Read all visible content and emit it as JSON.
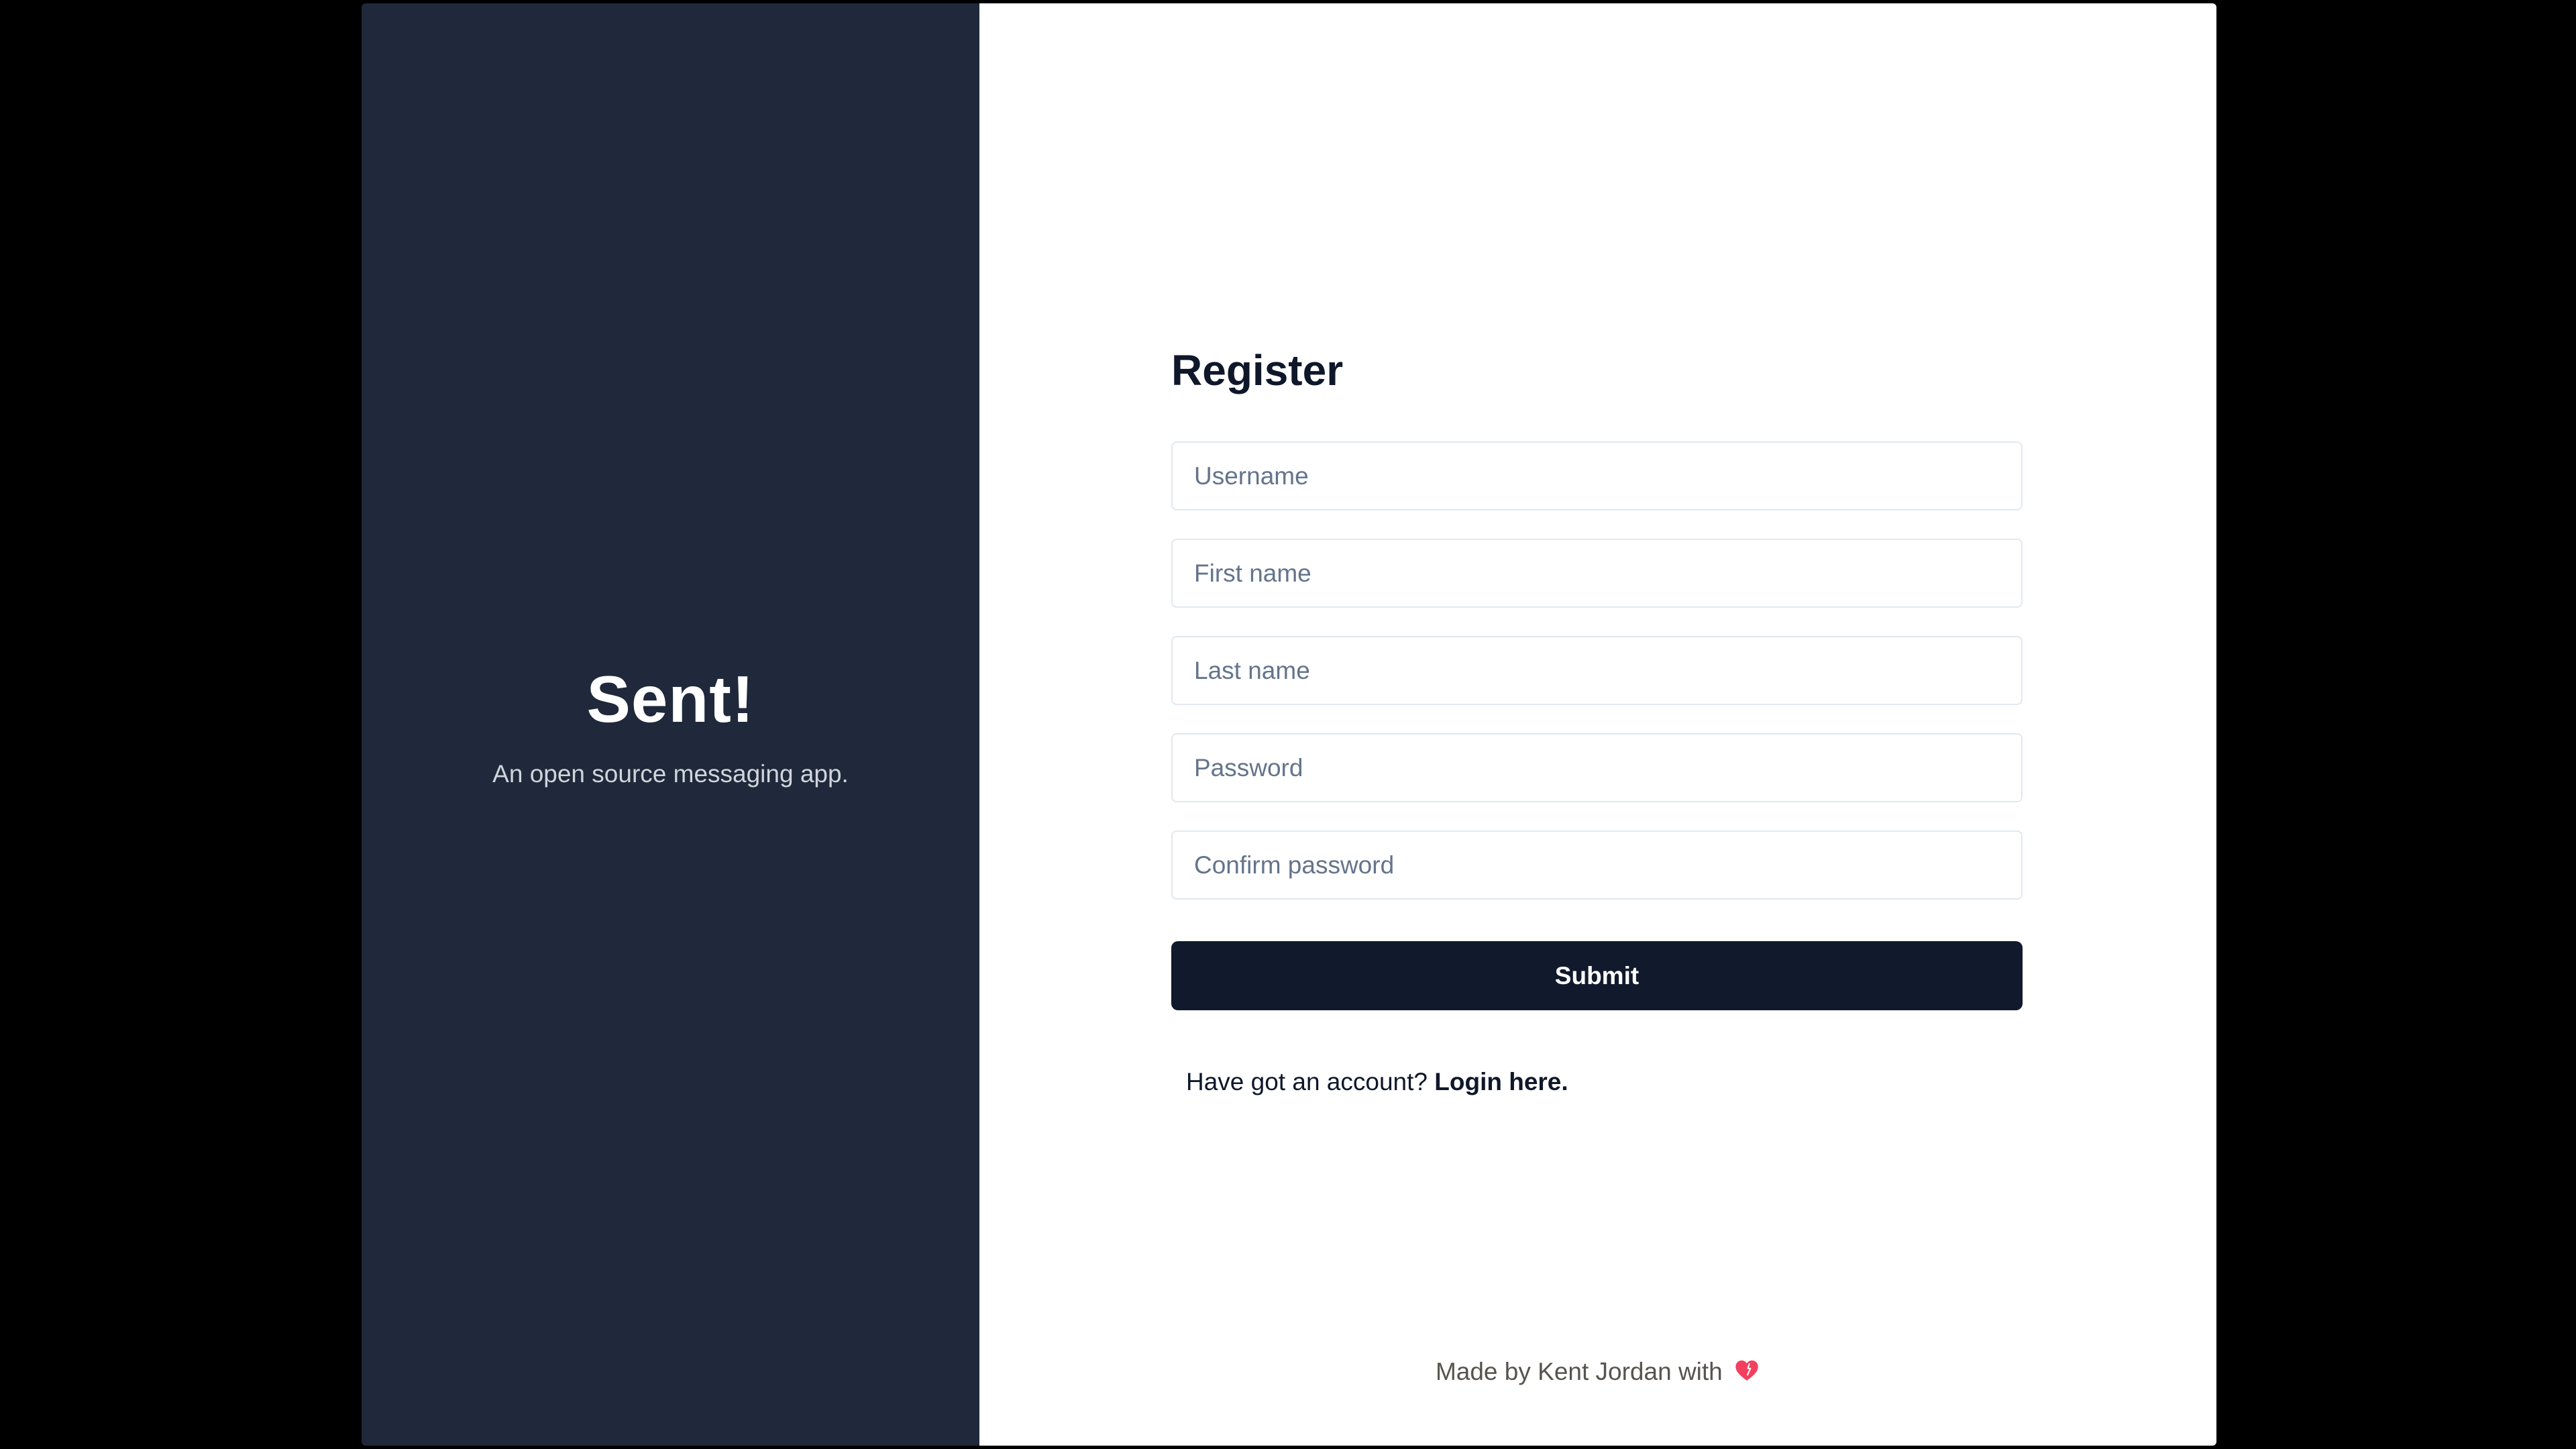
{
  "brand": {
    "title": "Sent!",
    "tagline": "An open source messaging app."
  },
  "form": {
    "title": "Register",
    "fields": {
      "username": {
        "placeholder": "Username",
        "value": ""
      },
      "first_name": {
        "placeholder": "First name",
        "value": ""
      },
      "last_name": {
        "placeholder": "Last name",
        "value": ""
      },
      "password": {
        "placeholder": "Password",
        "value": ""
      },
      "confirm_password": {
        "placeholder": "Confirm password",
        "value": ""
      }
    },
    "submit_label": "Submit",
    "login_prompt": "Have got an account?",
    "login_link": "Login here."
  },
  "footer": {
    "text": "Made by Kent Jordan with",
    "icon": "heart-icon"
  },
  "colors": {
    "background": "#000000",
    "brand_panel": "#1f293b",
    "form_panel": "#ffffff",
    "button": "#111a2c",
    "heart": "#f43f5e"
  }
}
